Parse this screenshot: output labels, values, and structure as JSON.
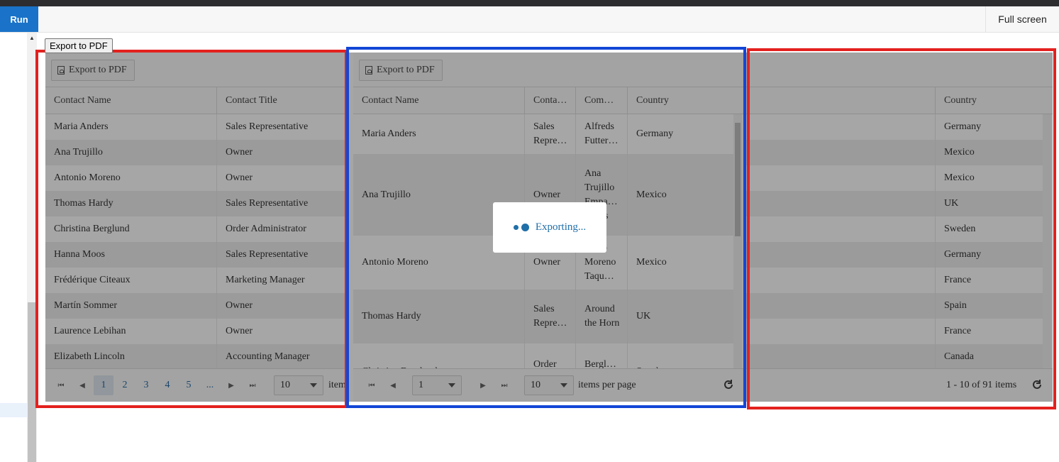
{
  "app": {
    "run_label": "Run",
    "fullscreen_label": "Full screen",
    "export_top_label": "Export to PDF"
  },
  "loader": {
    "text": "Exporting..."
  },
  "colors": {
    "red_frame": "#e3211e",
    "blue_frame": "#1346d6",
    "run_button": "#1a73c8"
  },
  "grid_left": {
    "export_label": "Export to PDF",
    "columns": [
      "Contact Name",
      "Contact Title"
    ],
    "rows": [
      [
        "Maria Anders",
        "Sales Representative"
      ],
      [
        "Ana Trujillo",
        "Owner"
      ],
      [
        "Antonio Moreno",
        "Owner"
      ],
      [
        "Thomas Hardy",
        "Sales Representative"
      ],
      [
        "Christina Berglund",
        "Order Administrator"
      ],
      [
        "Hanna Moos",
        "Sales Representative"
      ],
      [
        "Frédérique Citeaux",
        "Marketing Manager"
      ],
      [
        "Martín Sommer",
        "Owner"
      ],
      [
        "Laurence Lebihan",
        "Owner"
      ],
      [
        "Elizabeth Lincoln",
        "Accounting Manager"
      ]
    ],
    "pager": {
      "pages": [
        "1",
        "2",
        "3",
        "4",
        "5",
        "..."
      ],
      "selected_page": "1",
      "page_size": "10",
      "items_label": "items"
    }
  },
  "grid_middle": {
    "export_label": "Export to PDF",
    "columns": [
      "Contact Name",
      "Conta…",
      "Com…",
      "Country"
    ],
    "rows": [
      [
        "Maria Anders",
        "Sales Repre…",
        "Alfreds Futter…",
        "Germany"
      ],
      [
        "Ana Trujillo",
        "Owner",
        "Ana Trujillo Empa… …dos",
        "Mexico"
      ],
      [
        "Antonio Moreno",
        "Owner",
        "…nio Moreno Taqu…",
        "Mexico"
      ],
      [
        "Thomas Hardy",
        "Sales Repre…",
        "Around the Horn",
        "UK"
      ],
      [
        "Christina Berglund",
        "Order Admi…",
        "Bergl… …",
        "Sweden"
      ]
    ],
    "pager": {
      "page": "1",
      "page_size": "10",
      "items_label": "items per page"
    }
  },
  "grid_right": {
    "columns": [
      "Country"
    ],
    "rows": [
      "Germany",
      "Mexico",
      "Mexico",
      "UK",
      "Sweden",
      "Germany",
      "France",
      "Spain",
      "France",
      "Canada"
    ],
    "pager": {
      "summary": "1 - 10 of 91 items"
    }
  }
}
